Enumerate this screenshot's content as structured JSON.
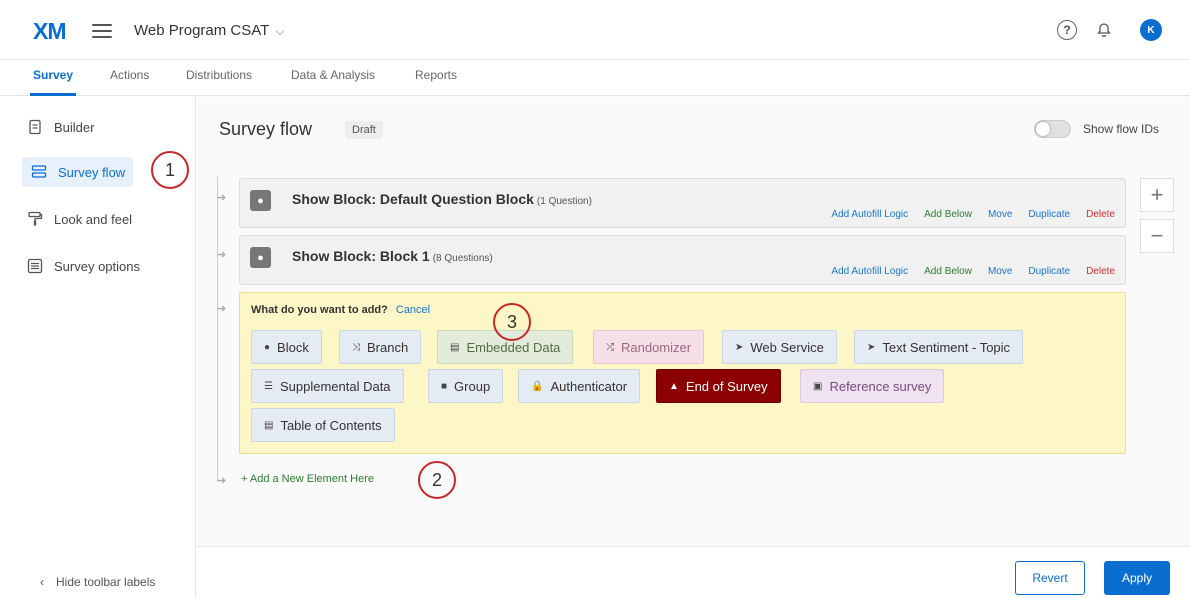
{
  "header": {
    "logo": "XM",
    "project_name": "Web Program CSAT",
    "chevron": "⌵",
    "help_symbol": "?",
    "bell_symbol": "🔔",
    "avatar_initial": "K"
  },
  "nav": {
    "tabs": [
      {
        "label": "Survey"
      },
      {
        "label": "Actions"
      },
      {
        "label": "Distributions"
      },
      {
        "label": "Data & Analysis"
      },
      {
        "label": "Reports"
      }
    ]
  },
  "sidebar": {
    "items": [
      {
        "label": "Builder",
        "icon": "builder-icon"
      },
      {
        "label": "Survey flow",
        "icon": "survey-flow-icon"
      },
      {
        "label": "Look and feel",
        "icon": "paint-roller-icon"
      },
      {
        "label": "Survey options",
        "icon": "survey-options-icon"
      }
    ],
    "hide_labels": "Hide toolbar labels",
    "hide_chevron": "‹"
  },
  "main": {
    "title": "Survey flow",
    "status": "Draft",
    "show_flow_ids": "Show flow IDs",
    "plus": "+",
    "minus": "−",
    "blocks": [
      {
        "title": "Show Block: Default Question Block",
        "count": "(1 Question)",
        "actions": [
          "Add Autofill Logic",
          "Add Below",
          "Move",
          "Duplicate",
          "Delete"
        ]
      },
      {
        "title": "Show Block: Block 1",
        "count": "(8 Questions)",
        "actions": [
          "Add Autofill Logic",
          "Add Below",
          "Move",
          "Duplicate",
          "Delete"
        ]
      }
    ],
    "add_panel": {
      "question": "What do you want to add?",
      "cancel": "Cancel",
      "options": [
        {
          "label": "Block",
          "icon": "●"
        },
        {
          "label": "Branch",
          "icon": "⤨"
        },
        {
          "label": "Embedded Data",
          "icon": "▤"
        },
        {
          "label": "Randomizer",
          "icon": "⤮"
        },
        {
          "label": "Web Service",
          "icon": "➤"
        },
        {
          "label": "Text Sentiment - Topic",
          "icon": "➤"
        },
        {
          "label": "Supplemental Data",
          "icon": "☰"
        },
        {
          "label": "Group",
          "icon": "■"
        },
        {
          "label": "Authenticator",
          "icon": "🔒"
        },
        {
          "label": "End of Survey",
          "icon": "▲"
        },
        {
          "label": "Reference survey",
          "icon": "▣"
        },
        {
          "label": "Table of Contents",
          "icon": "▤"
        }
      ]
    },
    "add_new_element": "+ Add a New Element Here",
    "annotations": [
      "1",
      "2",
      "3"
    ]
  },
  "footer": {
    "revert": "Revert",
    "apply": "Apply"
  },
  "colors": {
    "brand": "#0a6ed1",
    "annotation": "#c62828",
    "end_of_survey": "#8b0000",
    "panel": "#fdf7c8"
  }
}
